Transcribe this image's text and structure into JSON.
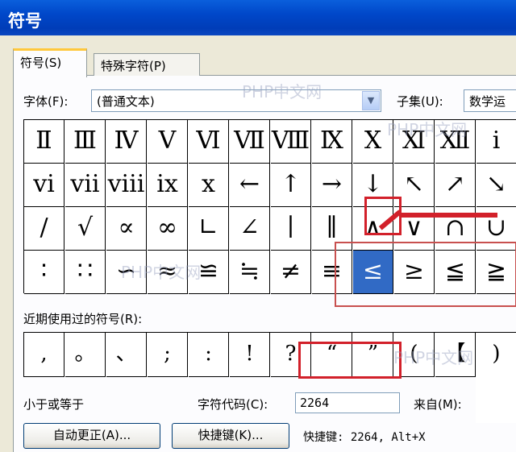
{
  "window": {
    "title": "符号"
  },
  "tabs": [
    {
      "label": "符号(S)",
      "active": true
    },
    {
      "label": "特殊字符(P)",
      "active": false
    }
  ],
  "font": {
    "label": "字体(F):",
    "value": "(普通文本)"
  },
  "subset": {
    "label": "子集(U):",
    "value": "数学运"
  },
  "symbol_grid": [
    [
      "Ⅱ",
      "Ⅲ",
      "Ⅳ",
      "Ⅴ",
      "Ⅵ",
      "Ⅶ",
      "Ⅷ",
      "Ⅸ",
      "Ⅹ",
      "Ⅺ",
      "Ⅻ",
      "ⅰ"
    ],
    [
      "ⅵ",
      "ⅶ",
      "ⅷ",
      "ⅸ",
      "ⅹ",
      "←",
      "↑",
      "→",
      "↓",
      "↖",
      "↗",
      "↘"
    ],
    [
      "∕",
      "√",
      "∝",
      "∞",
      "∟",
      "∠",
      "∣",
      "∥",
      "∧",
      "∨",
      "∩",
      "∪"
    ],
    [
      "∶",
      "∷",
      "∽",
      "≈",
      "≌",
      "≒",
      "≠",
      "≡",
      "≤",
      "≥",
      "≦",
      "≧"
    ]
  ],
  "selected_symbol": {
    "row": 3,
    "col": 8
  },
  "recent": {
    "label": "近期使用过的符号(R):",
    "symbols": [
      ",",
      "。",
      "、",
      ";",
      ":",
      "!",
      "?",
      "“",
      "”",
      "(",
      "【",
      ")"
    ]
  },
  "description": "小于或等于",
  "char_code": {
    "label": "字符代码(C):",
    "value": "2264"
  },
  "from": {
    "label": "来自(M):"
  },
  "buttons": {
    "autocorrect": "自动更正(A)...",
    "shortcut": "快捷键(K)..."
  },
  "shortcut_info": "快捷键: 2264, Alt+X",
  "watermark": "PHP中文网",
  "colors": {
    "title_bar": "#0047c9",
    "selection": "#316ac5",
    "annotation": "#d2202a"
  }
}
